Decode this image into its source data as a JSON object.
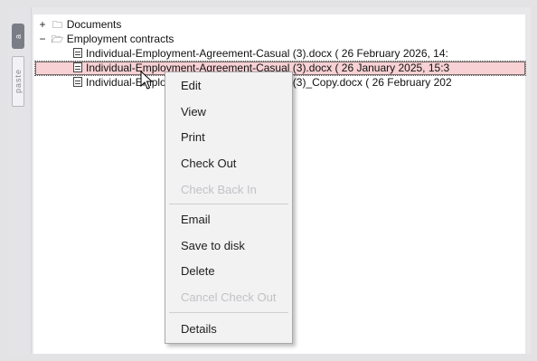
{
  "rail": {
    "active_tab_label": "a",
    "paste_tab_label": "paste"
  },
  "tree": {
    "rows": [
      {
        "expander": "+",
        "label": "Documents"
      },
      {
        "expander": "−",
        "label": "Employment contracts"
      },
      {
        "label": "Individual-Employment-Agreement-Casual (3).docx   ( 26 February 2026, 14:"
      },
      {
        "label": "Individual-Employment-Agreement-Casual (3).docx   ( 26 January 2025, 15:3"
      },
      {
        "label": "Individual-Employment-Agreement-Casual (3)_Copy.docx   ( 26 February 202"
      }
    ]
  },
  "context_menu": {
    "items": [
      {
        "label": "Edit",
        "enabled": true
      },
      {
        "label": "View",
        "enabled": true
      },
      {
        "label": "Print",
        "enabled": true
      },
      {
        "label": "Check Out",
        "enabled": true
      },
      {
        "label": "Check Back In",
        "enabled": false
      },
      {
        "label": "Email",
        "enabled": true
      },
      {
        "label": "Save to disk",
        "enabled": true
      },
      {
        "label": "Delete",
        "enabled": true
      },
      {
        "label": "Cancel Check Out",
        "enabled": false
      },
      {
        "label": "Details",
        "enabled": true
      }
    ]
  },
  "colors": {
    "selection": "#f7d1d4",
    "disabled_text": "#c2c2c6"
  }
}
